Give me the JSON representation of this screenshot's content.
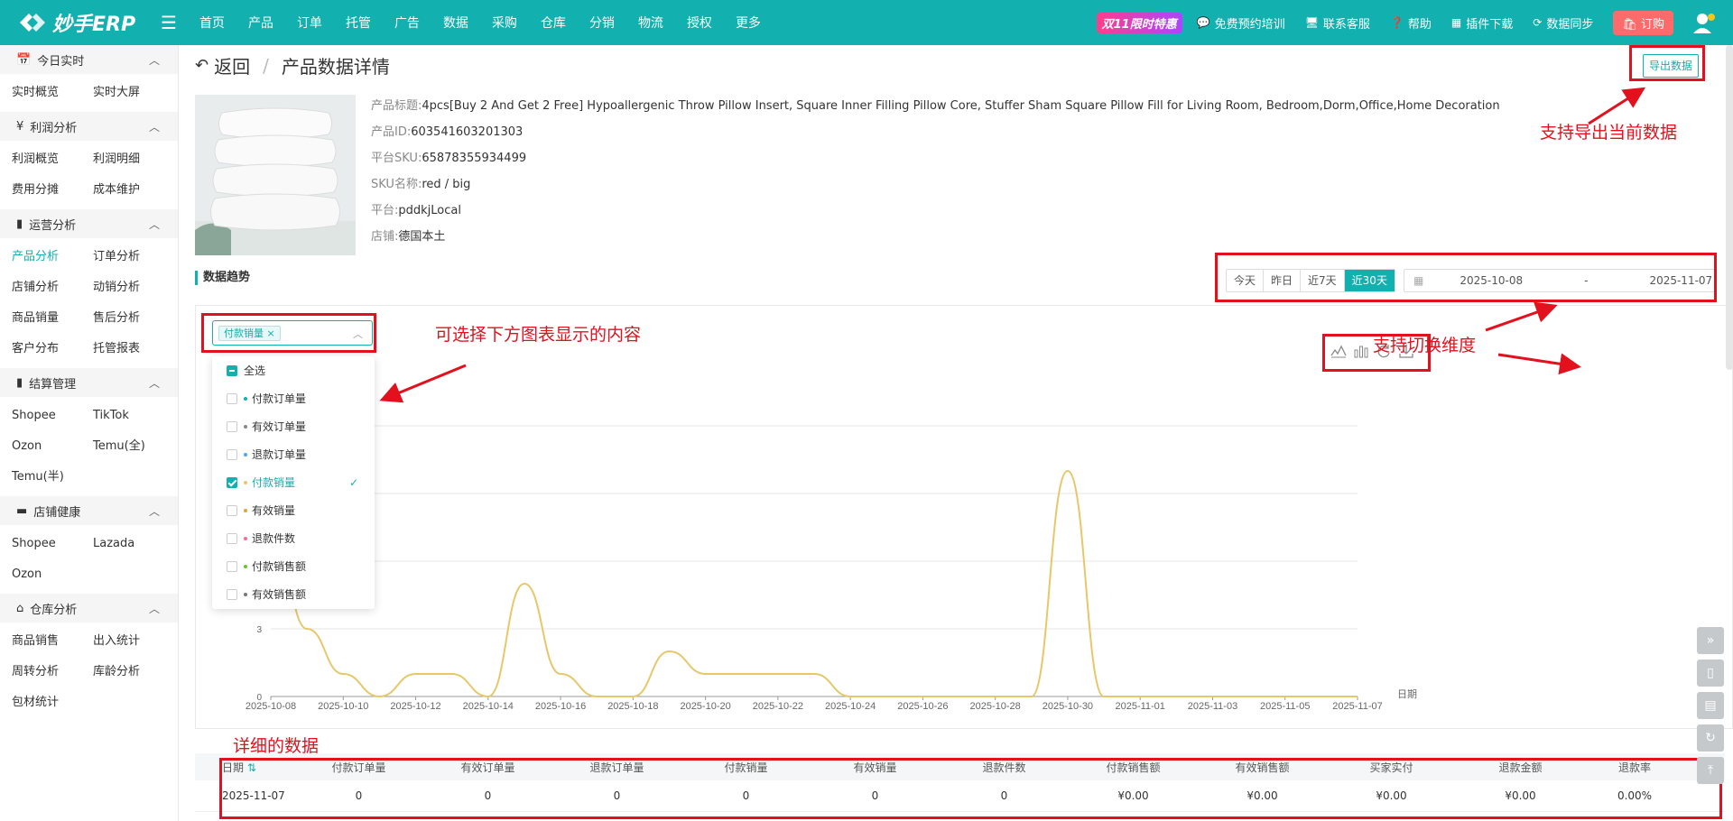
{
  "app": {
    "logo_text": "妙手ERP",
    "nav": [
      "首页",
      "产品",
      "订单",
      "托管",
      "广告",
      "数据",
      "采购",
      "仓库",
      "分销",
      "物流",
      "授权",
      "更多"
    ],
    "nav_dots": [
      2,
      3,
      7
    ],
    "promo": "双11限时特惠",
    "links": [
      {
        "icon": "chat-icon",
        "label": "免费预约培训"
      },
      {
        "icon": "service-icon",
        "label": "联系客服"
      },
      {
        "icon": "help-icon",
        "label": "帮助"
      },
      {
        "icon": "plugin-icon",
        "label": "插件下载"
      },
      {
        "icon": "sync-icon",
        "label": "数据同步"
      }
    ],
    "subscribe": "订购"
  },
  "sidebar": [
    {
      "title": "今日实时",
      "icon": "calendar-icon",
      "items": [
        "实时概览",
        "实时大屏"
      ]
    },
    {
      "title": "利润分析",
      "icon": "yen-icon",
      "items": [
        "利润概览",
        "利润明细",
        "费用分摊",
        "成本维护"
      ]
    },
    {
      "title": "运营分析",
      "icon": "bar-chart-icon",
      "items": [
        "产品分析",
        "订单分析",
        "店铺分析",
        "动销分析",
        "商品销量",
        "售后分析",
        "客户分布",
        "托管报表"
      ],
      "active": "产品分析"
    },
    {
      "title": "结算管理",
      "icon": "bar-chart-icon",
      "items": [
        "Shopee",
        "TikTok",
        "Ozon",
        "Temu(全)",
        "Temu(半)"
      ]
    },
    {
      "title": "店铺健康",
      "icon": "store-icon",
      "items": [
        "Shopee",
        "Lazada",
        "Ozon"
      ]
    },
    {
      "title": "仓库分析",
      "icon": "warehouse-icon",
      "items": [
        "商品销售",
        "出入统计",
        "周转分析",
        "库龄分析",
        "包材统计"
      ]
    }
  ],
  "breadcrumb": {
    "back": "返回",
    "current": "产品数据详情"
  },
  "export_label": "导出数据",
  "product": [
    {
      "label": "产品标题:",
      "value": "4pcs[Buy 2 And Get 2 Free] Hypoallergenic Throw Pillow Insert, Square Inner Filling Pillow Core, Stuffer Sham Square Pillow Fill for Living Room, Bedroom,Dorm,Office,Home Decoration"
    },
    {
      "label": "产品ID:",
      "value": "603541603201303"
    },
    {
      "label": "平台SKU:",
      "value": "65878355934499"
    },
    {
      "label": "SKU名称:",
      "value": "red / big"
    },
    {
      "label": "平台:",
      "value": "pddkjLocal"
    },
    {
      "label": "店铺:",
      "value": "德国本土"
    }
  ],
  "trend_title": "数据趋势",
  "range_buttons": [
    "今天",
    "昨日",
    "近7天",
    "近30天"
  ],
  "range_active": "近30天",
  "date_start": "2025-10-08",
  "date_sep": "-",
  "date_end": "2025-11-07",
  "select_tag": "付款销量",
  "dropdown": [
    {
      "label": "全选",
      "state": "indeterminate"
    },
    {
      "label": "付款订单量",
      "state": "unchecked",
      "color": "#12b0ae"
    },
    {
      "label": "有效订单量",
      "state": "unchecked",
      "color": "#888888"
    },
    {
      "label": "退款订单量",
      "state": "unchecked",
      "color": "#4da3ff"
    },
    {
      "label": "付款销量",
      "state": "checked",
      "color": "#e6c86b"
    },
    {
      "label": "有效销量",
      "state": "unchecked",
      "color": "#e6a23c"
    },
    {
      "label": "退款件数",
      "state": "unchecked",
      "color": "#f56c9a"
    },
    {
      "label": "付款销售额",
      "state": "unchecked",
      "color": "#67c23a"
    },
    {
      "label": "有效销售额",
      "state": "unchecked",
      "color": "#777777"
    }
  ],
  "annotations": {
    "export": "支持导出当前数据",
    "select": "可选择下方图表显示的内容",
    "dimension": "支持切换维度",
    "detail": "详细的数据"
  },
  "chart_data": {
    "type": "line",
    "x": [
      "2025-10-08",
      "2025-10-09",
      "2025-10-10",
      "2025-10-11",
      "2025-10-12",
      "2025-10-13",
      "2025-10-14",
      "2025-10-15",
      "2025-10-16",
      "2025-10-17",
      "2025-10-18",
      "2025-10-19",
      "2025-10-20",
      "2025-10-21",
      "2025-10-22",
      "2025-10-23",
      "2025-10-24",
      "2025-10-25",
      "2025-10-26",
      "2025-10-27",
      "2025-10-28",
      "2025-10-29",
      "2025-10-30",
      "2025-10-31",
      "2025-11-01",
      "2025-11-02",
      "2025-11-03",
      "2025-11-04",
      "2025-11-05",
      "2025-11-06",
      "2025-11-07"
    ],
    "x_tick_labels": [
      "2025-10-08",
      "2025-10-10",
      "2025-10-12",
      "2025-10-14",
      "2025-10-16",
      "2025-10-18",
      "2025-10-20",
      "2025-10-22",
      "2025-10-24",
      "2025-10-26",
      "2025-10-28",
      "2025-10-30",
      "2025-11-01",
      "2025-11-03",
      "2025-11-05",
      "2025-11-07"
    ],
    "series": [
      {
        "name": "付款销量",
        "color": "#e6c86b",
        "values": [
          8,
          3,
          1,
          0,
          1,
          1,
          0,
          5,
          1,
          0,
          0,
          2,
          1,
          1,
          1,
          1,
          0,
          0,
          0,
          0,
          0,
          0,
          10,
          0,
          0,
          0,
          0,
          0,
          0,
          0,
          0
        ]
      }
    ],
    "y_ticks": [
      0,
      3
    ],
    "ylim": [
      0,
      12
    ],
    "xlabel": "日期",
    "grid": true
  },
  "table": {
    "headers": [
      "日期",
      "付款订单量",
      "有效订单量",
      "退款订单量",
      "付款销量",
      "有效销量",
      "退款件数",
      "付款销售额",
      "有效销售额",
      "买家实付",
      "退款金额",
      "退款率"
    ],
    "rows": [
      [
        "2025-11-07",
        "0",
        "0",
        "0",
        "0",
        "0",
        "0",
        "¥0.00",
        "¥0.00",
        "¥0.00",
        "¥0.00",
        "0.00%"
      ]
    ]
  }
}
